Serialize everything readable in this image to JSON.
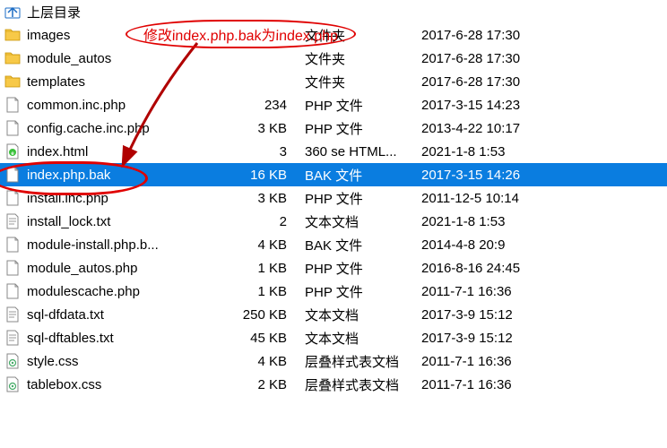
{
  "parent_dir": {
    "label": "上层目录"
  },
  "annotation": {
    "text": "修改index.php.bak为index.php"
  },
  "rows": [
    {
      "name": "images",
      "size": "",
      "type": "文件夹",
      "date": "2017-6-28 17:30",
      "icon": "folder",
      "selected": false
    },
    {
      "name": "module_autos",
      "size": "",
      "type": "文件夹",
      "date": "2017-6-28 17:30",
      "icon": "folder",
      "selected": false
    },
    {
      "name": "templates",
      "size": "",
      "type": "文件夹",
      "date": "2017-6-28 17:30",
      "icon": "folder",
      "selected": false
    },
    {
      "name": "common.inc.php",
      "size": "234",
      "type": "PHP 文件",
      "date": "2017-3-15 14:23",
      "icon": "file",
      "selected": false
    },
    {
      "name": "config.cache.inc.php",
      "size": "3 KB",
      "type": "PHP 文件",
      "date": "2013-4-22 10:17",
      "icon": "file",
      "selected": false
    },
    {
      "name": "index.html",
      "size": "3",
      "type": "360 se HTML...",
      "date": "2021-1-8 1:53",
      "icon": "html",
      "selected": false
    },
    {
      "name": "index.php.bak",
      "size": "16 KB",
      "type": "BAK 文件",
      "date": "2017-3-15 14:26",
      "icon": "file",
      "selected": true
    },
    {
      "name": "install.inc.php",
      "size": "3 KB",
      "type": "PHP 文件",
      "date": "2011-12-5 10:14",
      "icon": "file",
      "selected": false
    },
    {
      "name": "install_lock.txt",
      "size": "2",
      "type": "文本文档",
      "date": "2021-1-8 1:53",
      "icon": "txt",
      "selected": false
    },
    {
      "name": "module-install.php.b...",
      "size": "4 KB",
      "type": "BAK 文件",
      "date": "2014-4-8 20:9",
      "icon": "file",
      "selected": false
    },
    {
      "name": "module_autos.php",
      "size": "1 KB",
      "type": "PHP 文件",
      "date": "2016-8-16 24:45",
      "icon": "file",
      "selected": false
    },
    {
      "name": "modulescache.php",
      "size": "1 KB",
      "type": "PHP 文件",
      "date": "2011-7-1 16:36",
      "icon": "file",
      "selected": false
    },
    {
      "name": "sql-dfdata.txt",
      "size": "250 KB",
      "type": "文本文档",
      "date": "2017-3-9 15:12",
      "icon": "txt",
      "selected": false
    },
    {
      "name": "sql-dftables.txt",
      "size": "45 KB",
      "type": "文本文档",
      "date": "2017-3-9 15:12",
      "icon": "txt",
      "selected": false
    },
    {
      "name": "style.css",
      "size": "4 KB",
      "type": "层叠样式表文档",
      "date": "2011-7-1 16:36",
      "icon": "css",
      "selected": false
    },
    {
      "name": "tablebox.css",
      "size": "2 KB",
      "type": "层叠样式表文档",
      "date": "2011-7-1 16:36",
      "icon": "css",
      "selected": false
    }
  ]
}
